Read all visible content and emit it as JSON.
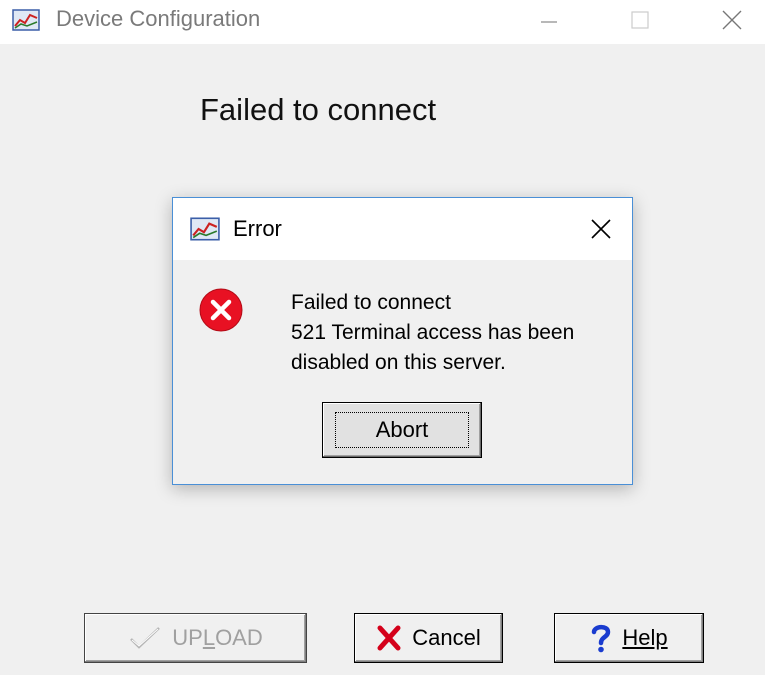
{
  "window": {
    "title": "Device Configuration",
    "status_heading": "Failed to connect"
  },
  "buttons": {
    "upload_label": "UPLOAD",
    "cancel_label": "Cancel",
    "help_label": "Help",
    "upload_enabled": false
  },
  "dialog": {
    "title": "Error",
    "message_line1": "Failed to connect",
    "message_line2": "521 Terminal access has been",
    "message_line3": "disabled on this server.",
    "abort_label": "Abort",
    "icon": "error-icon"
  },
  "colors": {
    "dialog_border": "#4a8fd6",
    "error_red": "#e81123",
    "cancel_x_red": "#d4001a",
    "help_blue": "#1a3ccf"
  }
}
